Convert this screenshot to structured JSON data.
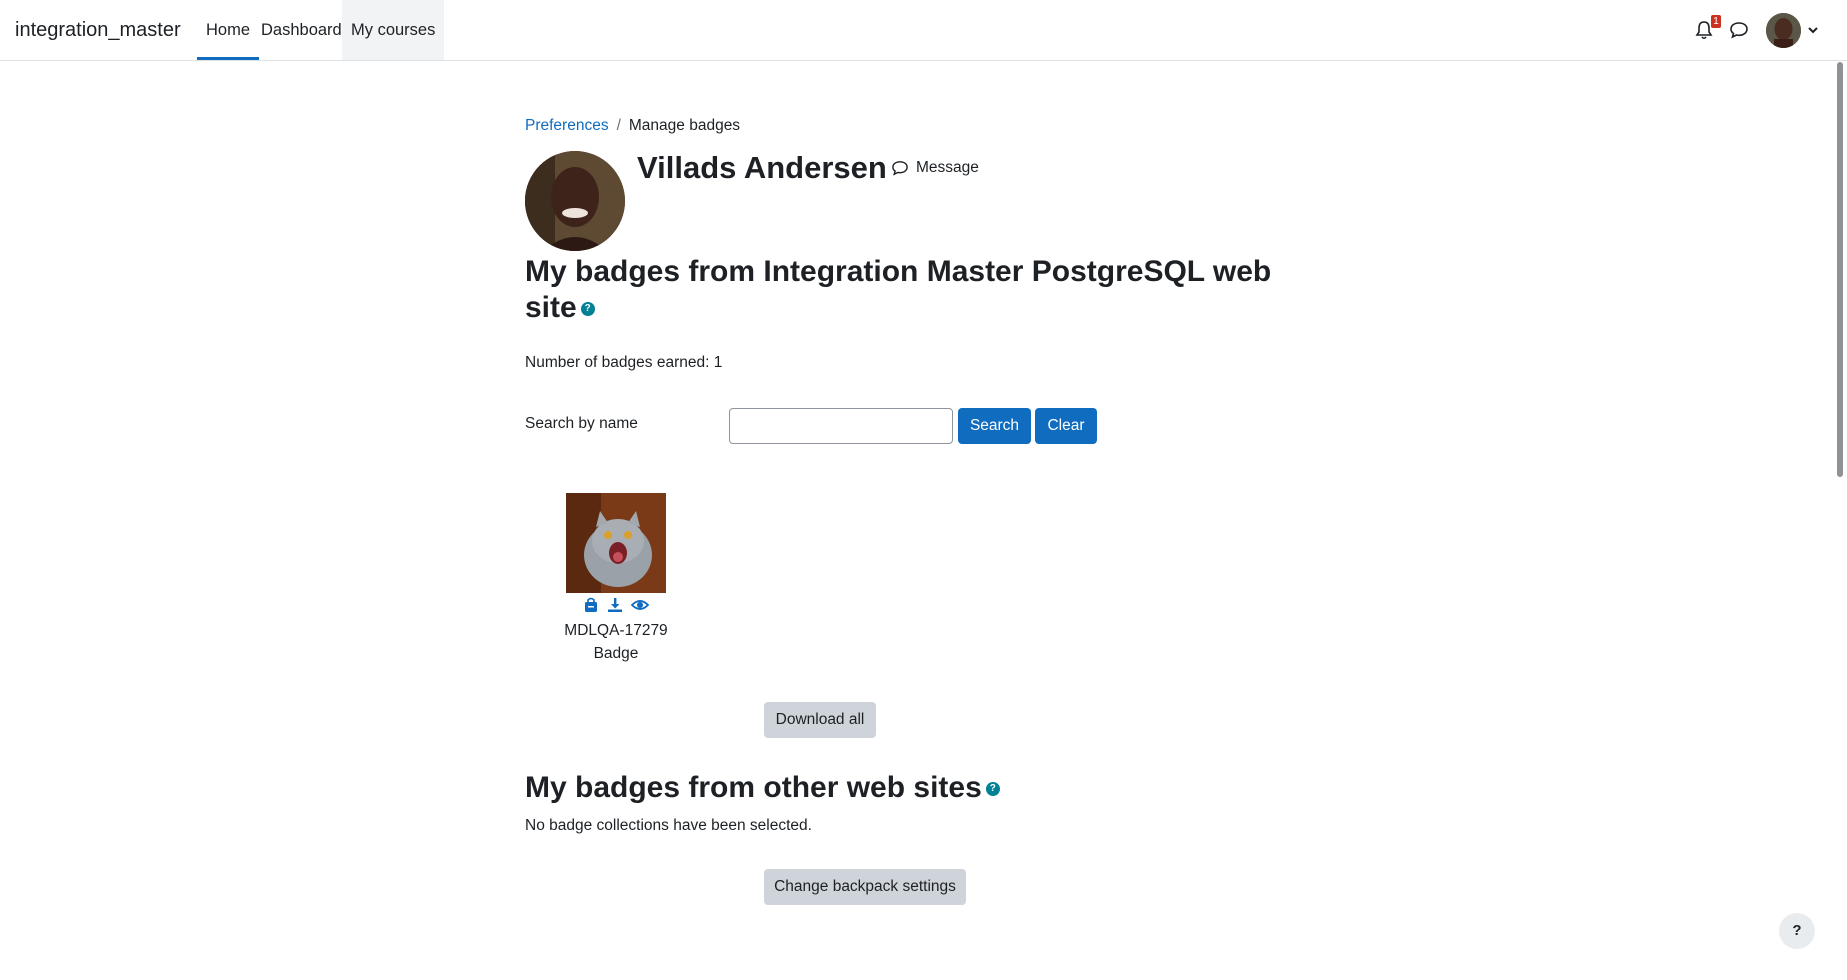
{
  "navbar": {
    "site_name": "integration_master",
    "links": [
      "Home",
      "Dashboard",
      "My courses"
    ],
    "notification_count": "1"
  },
  "breadcrumb": {
    "parent": "Preferences",
    "separator": "/",
    "current": "Manage badges"
  },
  "profile": {
    "name": "Villads Andersen",
    "message_label": "Message"
  },
  "site_badges": {
    "heading": "My badges from Integration Master PostgreSQL web site",
    "count_text": "Number of badges earned: 1",
    "search_label": "Search by name",
    "search_value": "",
    "search_button": "Search",
    "clear_button": "Clear",
    "badges": [
      {
        "name_line1": "MDLQA-17279",
        "name_line2": "Badge"
      }
    ],
    "download_all": "Download all"
  },
  "other_badges": {
    "heading": "My badges from other web sites",
    "empty_text": "No badge collections have been selected.",
    "backpack_button": "Change backpack settings"
  },
  "help_fab": "?",
  "colors": {
    "primary": "#0f6cbf",
    "help_icon": "#008196",
    "notification_badge": "#ca3120",
    "secondary_button": "#ced4da"
  }
}
